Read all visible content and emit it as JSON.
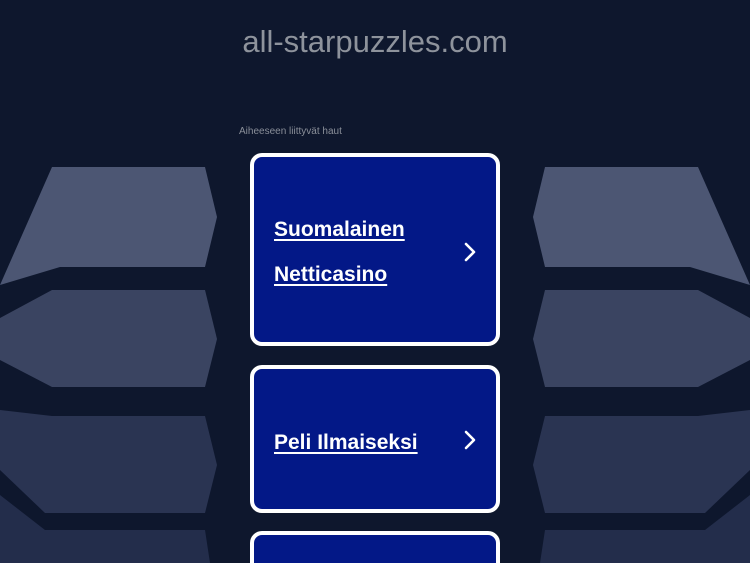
{
  "header": {
    "domain": "all-starpuzzles.com"
  },
  "related": {
    "label": "Aiheeseen liittyvät haut",
    "links": [
      {
        "line1": "Suomalainen",
        "line2": "Netticasino"
      },
      {
        "line1": "Peli Ilmaiseksi"
      },
      {
        "line1": ""
      }
    ]
  },
  "icons": {
    "link_arrow": "chevron-right-icon"
  },
  "colors": {
    "background": "#0e172d",
    "card": "#031887",
    "card_border": "#ffffff",
    "title_text": "#8e939c"
  }
}
